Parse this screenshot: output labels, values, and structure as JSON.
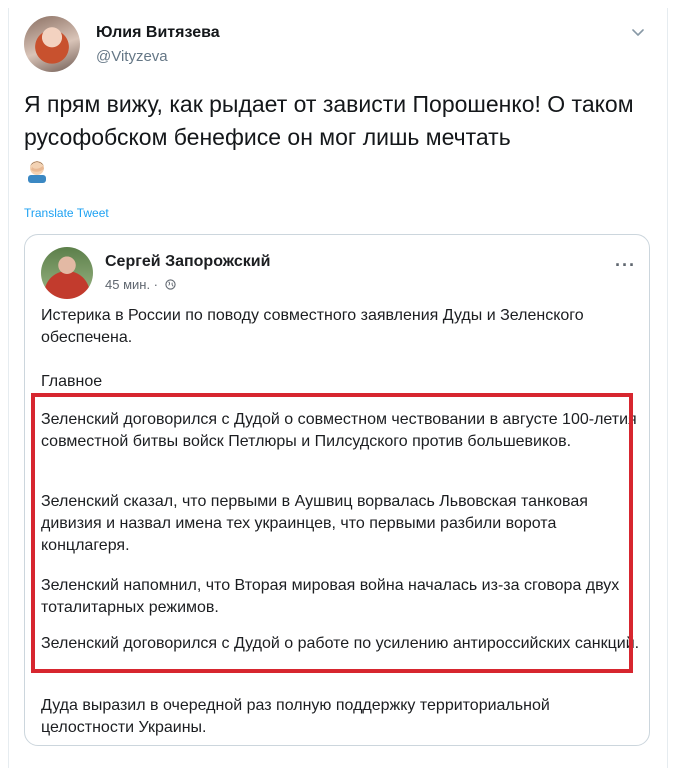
{
  "tweet": {
    "author_name": "Юлия Витязева",
    "author_handle": "@Vityzeva",
    "text": "Я прям вижу, как рыдает от зависти Порошенко! О таком русофобском бенефисе он мог лишь мечтать",
    "emoji_icon": "facepalm-emoji",
    "translate_label": "Translate Tweet",
    "accent_color": "#1da1f2"
  },
  "card": {
    "author_name": "Сергей Запорожский",
    "time": "45 мин. ·",
    "menu_label": "···",
    "intro": "Истерика в России по поводу совместного заявления Дуды и Зеленского обеспечена.",
    "heading": "Главное",
    "points": [
      "Зеленский договорился с Дудой о совместном чествовании в августе 100-летия совместной битвы войск Петлюры и Пилсудского против большевиков.",
      "Зеленский сказал, что первыми в Аушвиц ворвалась Львовская танковая дивизия и назвал имена тех украинцев, что первыми разбили ворота концлагеря.",
      "Зеленский напомнил, что Вторая мировая война началась из-за сговора двух тоталитарных режимов.",
      "Зеленский договорился с Дудой о работе по усилению антироссийских санкций."
    ],
    "conclusion": "Дуда выразил в очередной раз полную поддержку территориальной целостности Украины.",
    "highlight_color": "#d7262f"
  }
}
